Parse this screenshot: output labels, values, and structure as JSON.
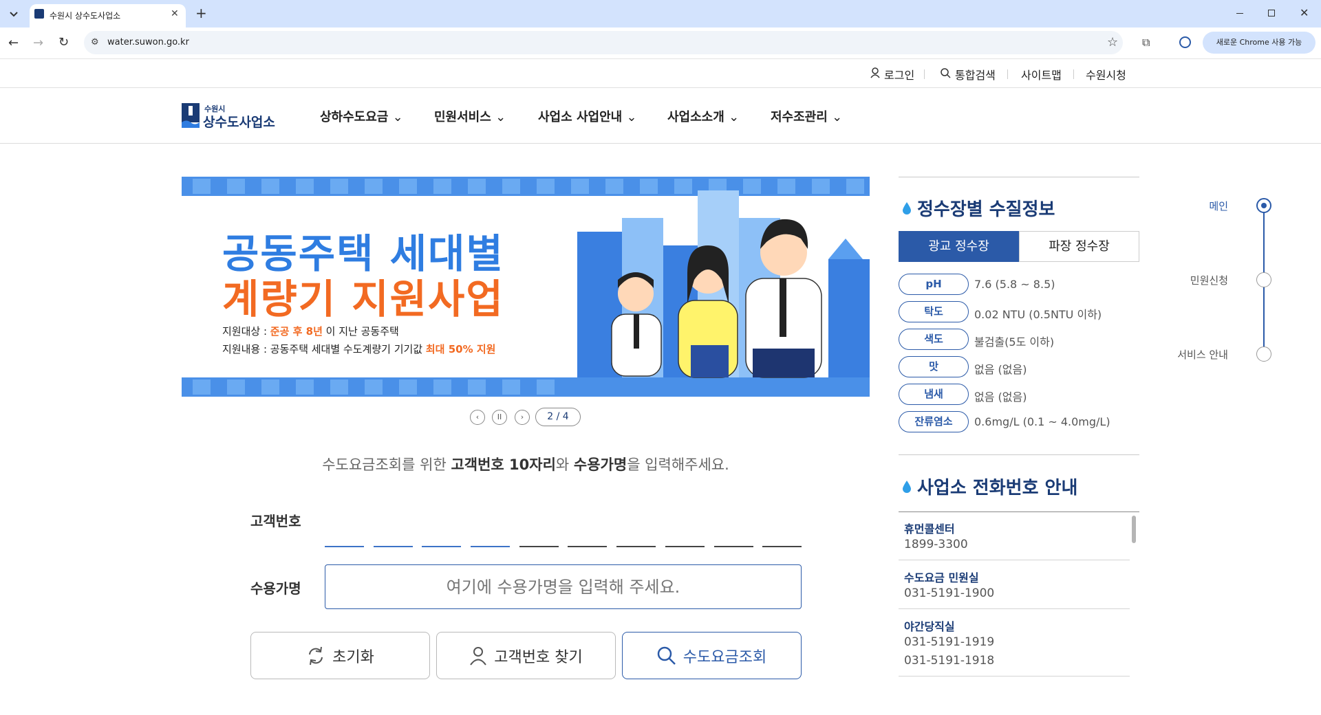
{
  "browser": {
    "tab_title": "수원시 상수도사업소",
    "url": "water.suwon.go.kr",
    "chrome_pill": "새로운 Chrome 사용 가능"
  },
  "util_nav": {
    "login": "로그인",
    "search": "통합검색",
    "sitemap": "사이트맵",
    "city_hall": "수원시청"
  },
  "logo": {
    "small": "수원시",
    "big": "상수도사업소"
  },
  "gnb": [
    {
      "label": "상하수도요금"
    },
    {
      "label": "민원서비스"
    },
    {
      "label": "사업소 사업안내"
    },
    {
      "label": "사업소소개"
    },
    {
      "label": "저수조관리"
    }
  ],
  "banner": {
    "title_line1": "공동주택 세대별",
    "title_line2": "계량기 지원사업",
    "target_label": "지원대상 : ",
    "target_highlight": "준공 후 8년",
    "target_rest": " 이 지난 공동주택",
    "content_label": "지원내용 : 공동주택 세대별 수도계량기 기기값 ",
    "content_highlight": "최대 50% 지원"
  },
  "pager": {
    "prev": "‹",
    "pause": "II",
    "next": "›",
    "count": "2 / 4"
  },
  "form": {
    "prompt_pre": "수도요금조회를 위한 ",
    "prompt_b1": "고객번호 10자리",
    "prompt_mid": "와 ",
    "prompt_b2": "수용가명",
    "prompt_post": "을 입력해주세요.",
    "customer_label": "고객번호",
    "name_label": "수용가명",
    "name_placeholder": "여기에 수용가명을 입력해 주세요.",
    "reset": "초기화",
    "find": "고객번호 찾기",
    "inquiry": "수도요금조회"
  },
  "water_quality": {
    "title": "정수장별 수질정보",
    "tabs": [
      "광교 정수장",
      "파장 정수장"
    ],
    "items": [
      {
        "label": "pH",
        "value": "7.6 (5.8 ~ 8.5)"
      },
      {
        "label": "탁도",
        "value": "0.02 NTU (0.5NTU 이하)"
      },
      {
        "label": "색도",
        "value": "불검출(5도 이하)"
      },
      {
        "label": "맛",
        "value": "없음 (없음)"
      },
      {
        "label": "냄새",
        "value": "없음 (없음)"
      },
      {
        "label": "잔류염소",
        "value": "0.6mg/L (0.1 ~ 4.0mg/L)"
      }
    ]
  },
  "phone": {
    "title": "사업소 전화번호 안내",
    "items": [
      {
        "name": "휴먼콜센터",
        "numbers": [
          "1899-3300"
        ]
      },
      {
        "name": "수도요금 민원실",
        "numbers": [
          "031-5191-1900"
        ]
      },
      {
        "name": "야간당직실",
        "numbers": [
          "031-5191-1919",
          "031-5191-1918"
        ]
      }
    ]
  },
  "side_nav": {
    "items": [
      "메인",
      "민원신청",
      "서비스 안내"
    ]
  },
  "colors": {
    "brand_blue": "#2b5aa8",
    "navy": "#1a3b75",
    "banner_blue": "#2f7de1",
    "banner_orange": "#f26a22"
  }
}
